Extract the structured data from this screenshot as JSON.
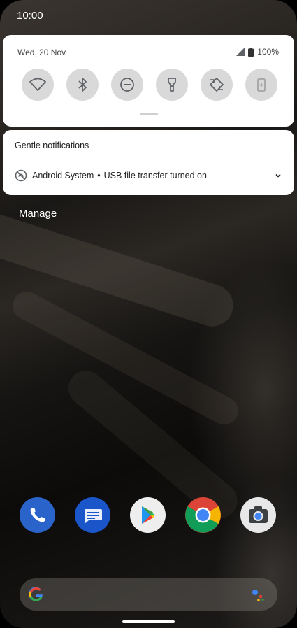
{
  "status_bar": {
    "time": "10:00"
  },
  "quick_settings": {
    "date": "Wed, 20 Nov",
    "battery_percent": "100%",
    "tiles": [
      {
        "name": "wifi-icon"
      },
      {
        "name": "bluetooth-icon"
      },
      {
        "name": "do-not-disturb-icon"
      },
      {
        "name": "flashlight-icon"
      },
      {
        "name": "auto-rotate-icon"
      },
      {
        "name": "battery-saver-icon"
      }
    ]
  },
  "notifications": {
    "section_header": "Gentle notifications",
    "items": [
      {
        "app": "Android System",
        "separator": "•",
        "text": "USB file transfer turned on"
      }
    ]
  },
  "manage_label": "Manage",
  "dock": {
    "apps": [
      "phone-app-icon",
      "messages-app-icon",
      "play-store-app-icon",
      "chrome-app-icon",
      "camera-app-icon"
    ]
  },
  "colors": {
    "panel": "#ffffff",
    "tile_bg": "#d9d9d9",
    "phone_blue": "#2a63c9",
    "messages_blue": "#1a56c9"
  }
}
